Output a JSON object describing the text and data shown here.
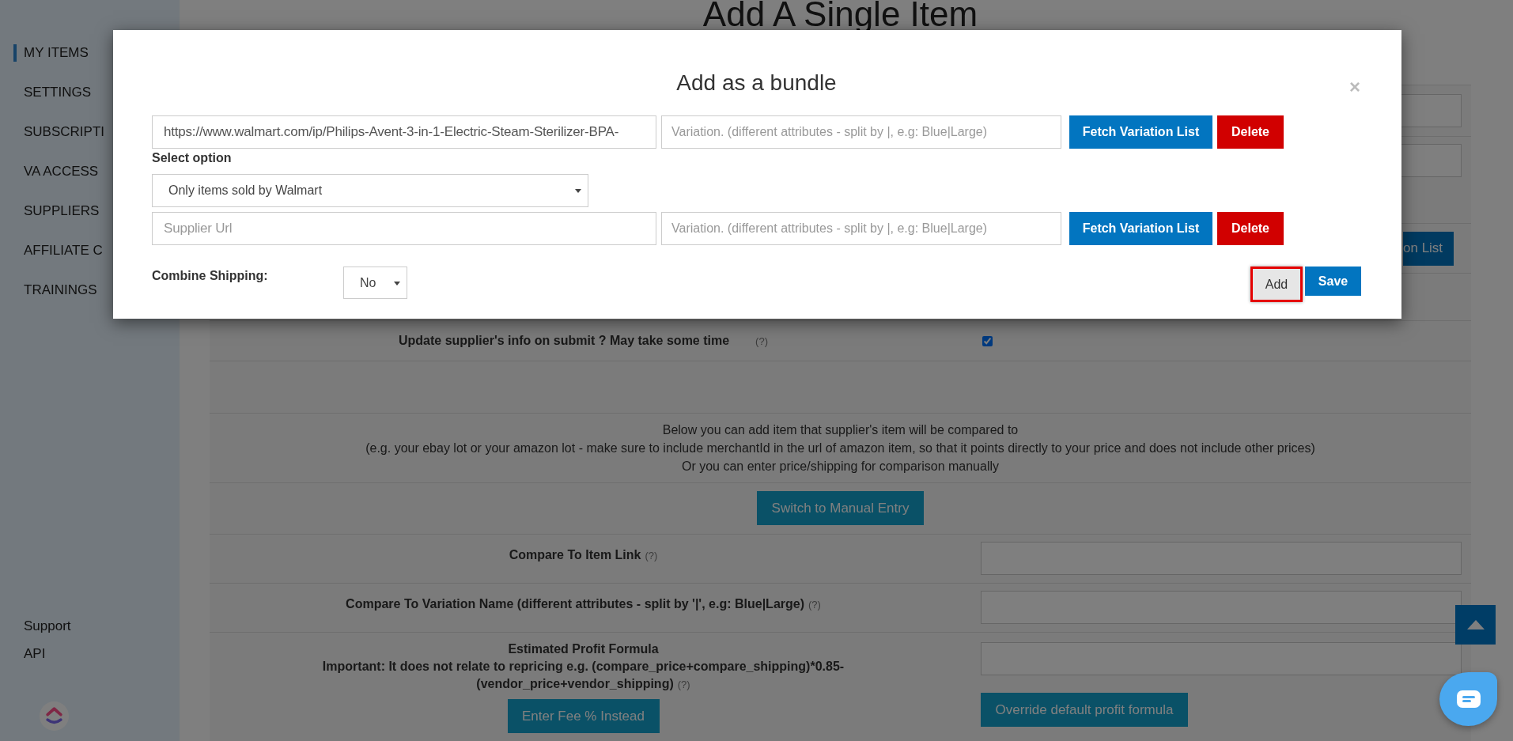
{
  "sidebar": {
    "items": [
      {
        "label": "MY ITEMS",
        "selected": true
      },
      {
        "label": "SETTINGS",
        "selected": false
      },
      {
        "label": "SUBSCRIPTI",
        "selected": false
      },
      {
        "label": "VA ACCESS",
        "selected": false
      },
      {
        "label": "SUPPLIERS",
        "selected": false
      },
      {
        "label": "AFFILIATE C",
        "selected": false
      },
      {
        "label": "TRAININGS",
        "selected": false
      }
    ],
    "footer_links": [
      "Support",
      "API"
    ]
  },
  "page": {
    "title": "Add A Single Item",
    "fetch_button": "on List",
    "update_row": {
      "label": "Update supplier's info on submit ? May take some time",
      "help": "(?)",
      "checked": true
    },
    "notice": [
      "Below you can add item that supplier's item will be compared to",
      "(e.g. your ebay lot or your amazon lot - make sure to include merchantId in the url of amazon item, so that it points directly to your price and does not include other prices)",
      "Or you can enter price/shipping for comparison manually"
    ],
    "switch_button": "Switch to Manual Entry",
    "compare_link": {
      "label": "Compare To Item Link",
      "help": "(?)"
    },
    "compare_variation": {
      "label": "Compare To Variation Name (different attributes - split by '|', e.g: Blue|Large)",
      "help": "(?)"
    },
    "profit": {
      "title": "Estimated Profit Formula",
      "note": "Important: It does not relate to repricing e.g. (compare_price+compare_shipping)*0.85-",
      "note_end": "(vendor_price+vendor_shipping)",
      "help": "(?)",
      "fee_button": "Enter Fee % Instead",
      "override_button": "Override default profit formula"
    }
  },
  "modal": {
    "title": "Add as a bundle",
    "close": "×",
    "suppliers": [
      {
        "url": {
          "value": "https://www.walmart.com/ip/Philips-Avent-3-in-1-Electric-Steam-Sterilizer-BPA-"
        },
        "variation": {
          "placeholder": "Variation. (different attributes - split by |, e.g: Blue|Large)"
        },
        "fetch": "Fetch Variation List",
        "delete": "Delete",
        "option_label": "Select option",
        "option": "Only items sold by Walmart"
      },
      {
        "url": {
          "placeholder": "Supplier Url"
        },
        "variation": {
          "placeholder": "Variation. (different attributes - split by |, e.g: Blue|Large)"
        },
        "fetch": "Fetch Variation List",
        "delete": "Delete"
      }
    ],
    "combine_label": "Combine Shipping:",
    "combine_value": "No",
    "buttons": [
      {
        "label": "Add",
        "kind": "secondary",
        "focused": true
      },
      {
        "label": "Save",
        "kind": "primary",
        "focused": false
      }
    ]
  }
}
